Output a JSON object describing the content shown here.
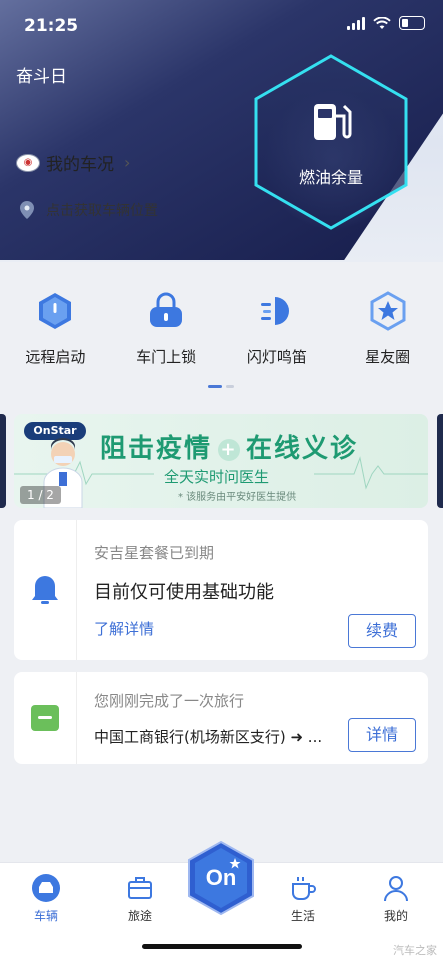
{
  "statusbar": {
    "time": "21:25"
  },
  "header": {
    "title": "奋斗日"
  },
  "car": {
    "status_label": "我的车况",
    "location_label": "点击获取车辆位置"
  },
  "fuel": {
    "label": "燃油余量"
  },
  "actions": [
    {
      "label": "远程启动",
      "icon": "remote-start-icon"
    },
    {
      "label": "车门上锁",
      "icon": "door-lock-icon"
    },
    {
      "label": "闪灯鸣笛",
      "icon": "flash-horn-icon"
    },
    {
      "label": "星友圈",
      "icon": "star-circle-icon"
    }
  ],
  "banner": {
    "brand": "OnStar",
    "heading_left": "阻击疫情",
    "heading_right": "在线义诊",
    "subheading": "全天实时问医生",
    "note": "* 该服务由平安好医生提供",
    "pager": "1 / 2"
  },
  "package_card": {
    "title": "安吉星套餐已到期",
    "message": "目前仅可使用基础功能",
    "link": "了解详情",
    "button": "续费"
  },
  "trip_card": {
    "title": "您刚刚完成了一次旅行",
    "destination": "中国工商银行(机场新区支行) ➜ ...",
    "button": "详情"
  },
  "tabbar": [
    {
      "label": "车辆",
      "icon": "car-icon"
    },
    {
      "label": "旅途",
      "icon": "suitcase-icon"
    },
    {
      "label": "On",
      "icon": "onstar-icon"
    },
    {
      "label": "生活",
      "icon": "cup-icon"
    },
    {
      "label": "我的",
      "icon": "person-icon"
    }
  ],
  "watermark": "汽车之家",
  "colors": {
    "accent": "#3d6fd6",
    "cyan": "#35e0f0",
    "green": "#1e9a72",
    "navy": "#1f2a4d"
  }
}
